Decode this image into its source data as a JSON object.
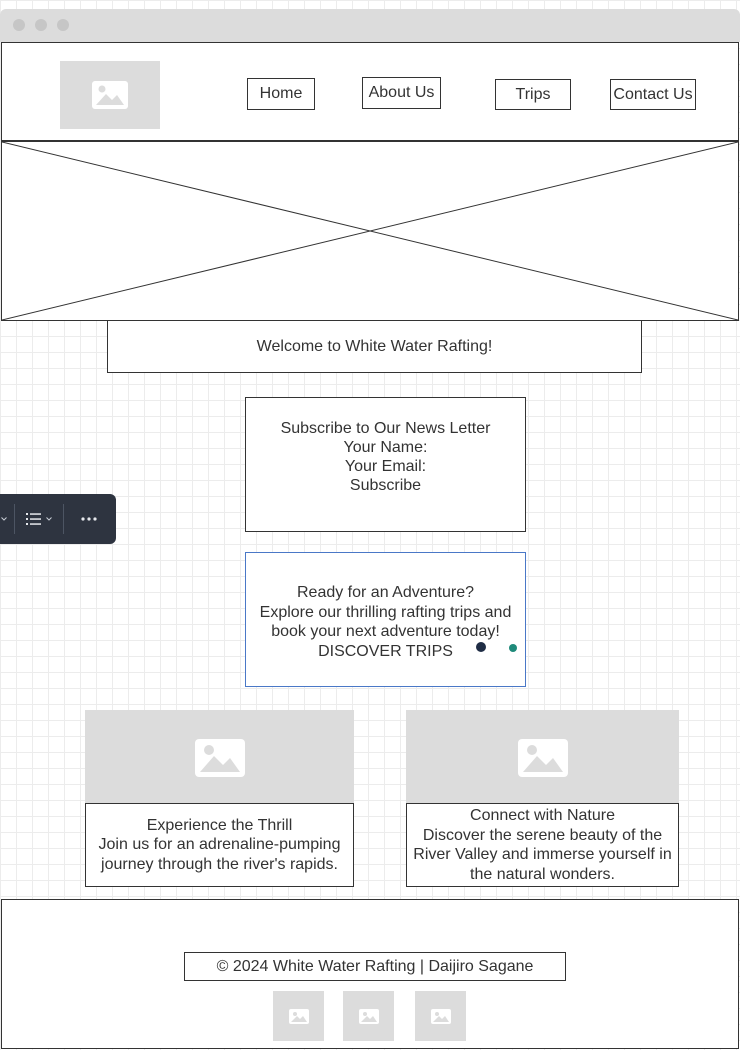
{
  "nav": {
    "items": [
      {
        "label": "Home"
      },
      {
        "label": "About Us"
      },
      {
        "label": "Trips"
      },
      {
        "label": "Contact Us"
      }
    ]
  },
  "welcome": {
    "text": "Welcome to White Water Rafting!"
  },
  "newsletter": {
    "title": "Subscribe to Our News Letter",
    "name_label": "Your Name:",
    "email_label": "Your Email:",
    "subscribe_label": "Subscribe"
  },
  "adventure": {
    "heading": "Ready for an Adventure?",
    "body": "Explore our thrilling rafting trips and book your next adventure today!",
    "cta_label": "DISCOVER TRIPS"
  },
  "cards": [
    {
      "title": "Experience the Thrill",
      "body": "Join us for an adrenaline-pumping journey through the river's rapids."
    },
    {
      "title": "Connect with Nature",
      "body": "Discover the serene beauty of the River Valley and immerse yourself in the natural wonders."
    }
  ],
  "footer": {
    "copyright": "© 2024 White Water Rafting | Daijiro Sagane"
  },
  "icons": {
    "image_placeholder": "image-icon",
    "list": "list-icon",
    "more": "more-icon",
    "chevron": "chevron-down-icon"
  },
  "colors": {
    "selection_border": "#4a78c7",
    "handle_navy": "#1f2d45",
    "handle_teal": "#1f8a7a",
    "toolbar_bg": "#2e3440",
    "placeholder_gray": "#dcdcdc"
  }
}
